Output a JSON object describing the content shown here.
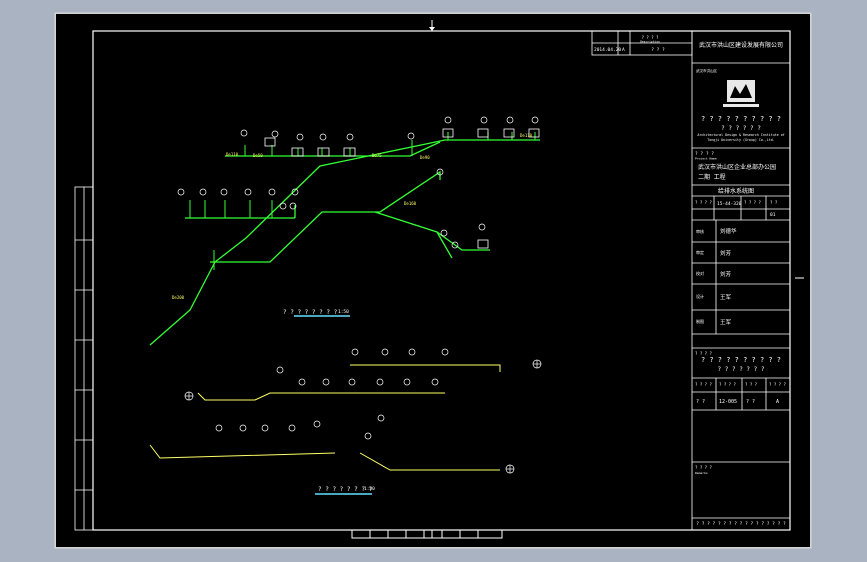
{
  "company": {
    "name": "武汉市洪山区建设发展有限公司",
    "logo_text": "武汉市洪山区",
    "english_line1": "Architectural Design & Research Institute of",
    "english_line2": "Tongji University (Group) Co.,Ltd.",
    "cn_placeholder": "? ? ? ? ? ? ? ? ? ?",
    "cn_placeholder2": "? ? ? ? ? ?"
  },
  "revision": {
    "date": "2014.04.20",
    "mark": "A",
    "note": "? ? ?",
    "header1": "? ? ? ?",
    "header2": "Description"
  },
  "title_block": {
    "project_label": "? ? ? ?",
    "project_label_en": "Project Name",
    "project_name_line1": "武汉市洪山区企业总部办公园",
    "project_name_line2": "二期 工程",
    "drawing_title": "给排水系统图",
    "drawing_no_label": "? ? ? ?",
    "drawing_no": "15-44-320",
    "col3": "? ? ? ?",
    "col4": "? ?",
    "col5": "01",
    "roles": [
      "审核",
      "审定",
      "校对",
      "设计",
      "制图"
    ],
    "role_values": [
      "刘德华",
      "刘芳",
      "刘芳",
      "王军",
      "王军"
    ],
    "stage_label": "? ? ? ?",
    "stage_value": "? ? ? ? ? ? ? ? ? ?",
    "stage_value2": "? ? ? ? ? ? ?",
    "sheet_labels": [
      "? ? ? ?",
      "? ? ? ?",
      "? ? ?",
      "? ? ? ?"
    ],
    "sheet_values": [
      "? ?",
      "12-005",
      "? ?",
      "A"
    ],
    "remarks_label": "? ? ? ?",
    "remarks_en": "Remarks",
    "footer": "? ? ? ? ? ? ? ? ? ? ? ? ? ? ? ? ?"
  },
  "diagrams": {
    "system_caption": "? ? ? ? ? ? ? ?",
    "system_scale": "1:50",
    "plan_caption": "? ? ? ? ? ? ? ?",
    "plan_scale": "1:50",
    "pipe_labels": [
      "De110",
      "De50",
      "De75",
      "De90",
      "De110",
      "De160",
      "De200"
    ]
  }
}
